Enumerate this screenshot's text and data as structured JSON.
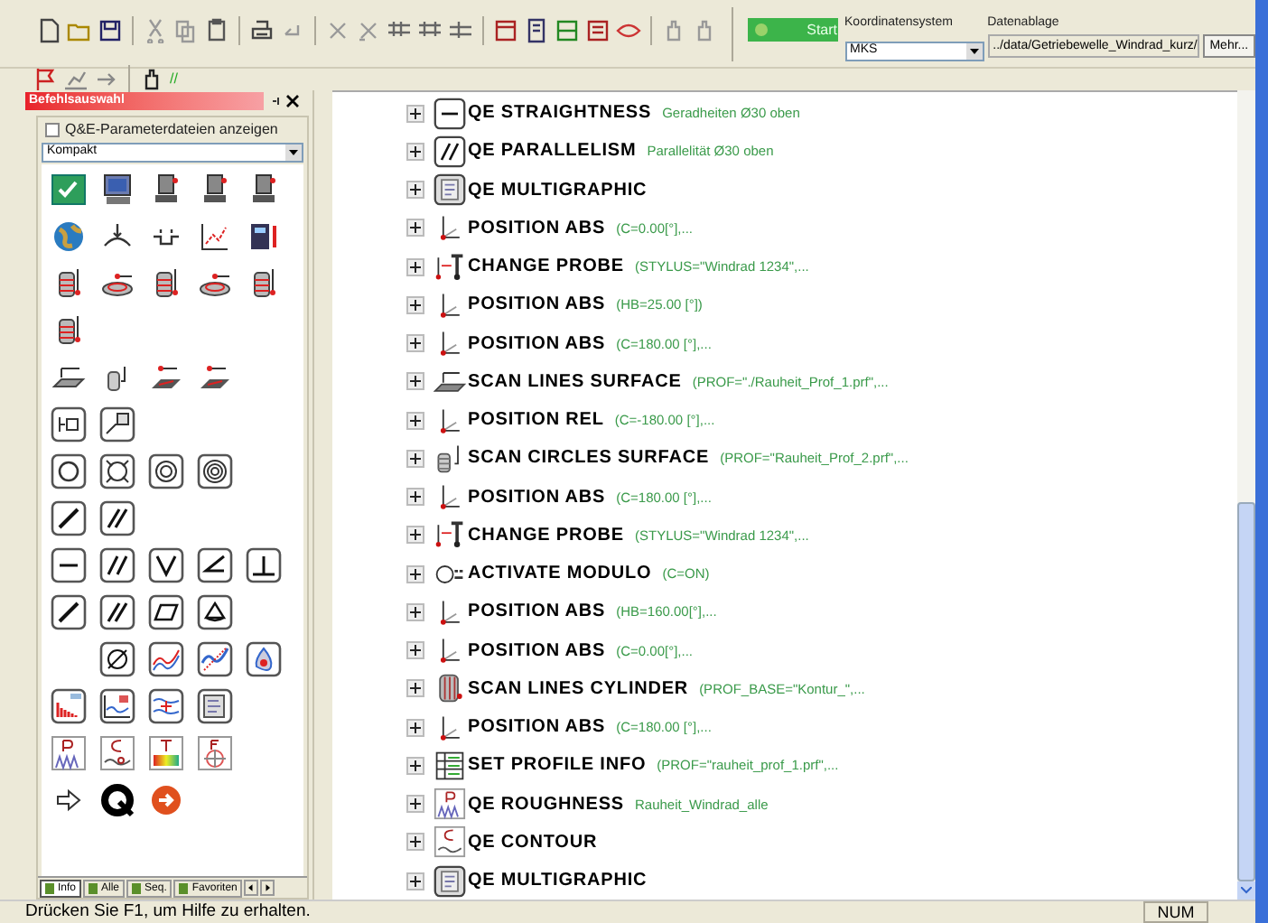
{
  "toolbar": {
    "start_button": "Start",
    "coordinate_system": {
      "label": "Koordinatensystem",
      "value": "MKS"
    },
    "data_storage": {
      "label": "Datenablage",
      "value": "../data/Getriebewelle_Windrad_kurz/"
    },
    "more_button": "Mehr..."
  },
  "toolbar_second_row": {
    "slashes": "//"
  },
  "command_panel": {
    "title": "Befehlsauswahl",
    "show_param_files": {
      "label": "Q&E-Parameterdateien anzeigen",
      "checked": false
    },
    "view_select": "Kompakt",
    "tabs": [
      {
        "label": "Info",
        "selected": true
      },
      {
        "label": "Alle",
        "selected": false
      },
      {
        "label": "Seq.",
        "selected": false
      },
      {
        "label": "Favoriten",
        "selected": false
      }
    ]
  },
  "program_tree": [
    {
      "kind": "straightness",
      "label": "QE STRAIGHTNESS",
      "parameter": "Geradheiten Ø30 oben"
    },
    {
      "kind": "parallelism",
      "label": "QE PARALLELISM",
      "parameter": "Parallelität Ø30 oben"
    },
    {
      "kind": "multigraphic",
      "label": "QE MULTIGRAPHIC"
    },
    {
      "kind": "position",
      "label": "POSITION ABS",
      "parameter": "(C=0.00[°],..."
    },
    {
      "kind": "probe",
      "label": "CHANGE PROBE",
      "parameter": "(STYLUS=\"Windrad 1234\",..."
    },
    {
      "kind": "position",
      "label": "POSITION ABS",
      "parameter": "(HB=25.00 [°])"
    },
    {
      "kind": "position",
      "label": "POSITION ABS",
      "parameter": "(C=180.00 [°],..."
    },
    {
      "kind": "scan_surface",
      "label": "SCAN LINES SURFACE",
      "parameter": "(PROF=\"./Rauheit_Prof_1.prf\",..."
    },
    {
      "kind": "position",
      "label": "POSITION REL",
      "parameter": "(C=-180.00 [°],..."
    },
    {
      "kind": "scan_circles",
      "label": "SCAN CIRCLES SURFACE",
      "parameter": "(PROF=\"Rauheit_Prof_2.prf\",..."
    },
    {
      "kind": "position",
      "label": "POSITION ABS",
      "parameter": "(C=180.00 [°],..."
    },
    {
      "kind": "probe",
      "label": "CHANGE PROBE",
      "parameter": "(STYLUS=\"Windrad 1234\",..."
    },
    {
      "kind": "modulo",
      "label": "ACTIVATE MODULO",
      "parameter": "(C=ON)"
    },
    {
      "kind": "position",
      "label": "POSITION ABS",
      "parameter": "(HB=160.00[°],..."
    },
    {
      "kind": "position",
      "label": "POSITION ABS",
      "parameter": "(C=0.00[°],..."
    },
    {
      "kind": "cylinder",
      "label": "SCAN LINES CYLINDER",
      "parameter": "(PROF_BASE=\"Kontur_\",..."
    },
    {
      "kind": "position",
      "label": "POSITION ABS",
      "parameter": "(C=180.00 [°],..."
    },
    {
      "kind": "profile_info",
      "label": "SET PROFILE INFO",
      "parameter": "(PROF=\"rauheit_prof_1.prf\",..."
    },
    {
      "kind": "roughness",
      "label": "QE ROUGHNESS",
      "parameter": "Rauheit_Windrad_alle"
    },
    {
      "kind": "contour",
      "label": "QE CONTOUR"
    },
    {
      "kind": "multigraphic",
      "label": "QE MULTIGRAPHIC"
    }
  ],
  "status_bar": {
    "message": "Drücken Sie F1, um Hilfe zu erhalten.",
    "num_indicator": "NUM"
  }
}
